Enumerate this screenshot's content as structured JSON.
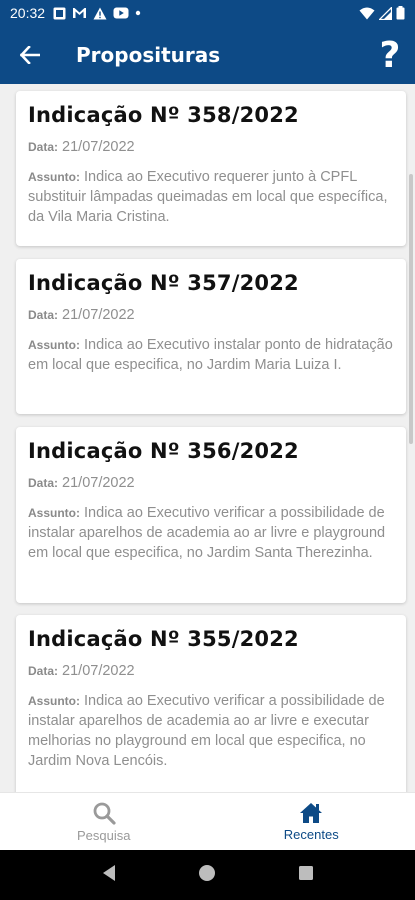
{
  "status": {
    "time": "20:32"
  },
  "header": {
    "title": "Proposituras",
    "help": "?"
  },
  "labels": {
    "date": "Data:",
    "subject": "Assunto:"
  },
  "cards": [
    {
      "title": "Indicação Nº 358/2022",
      "date": "21/07/2022",
      "subject": "Indica ao Executivo requerer junto à CPFL substituir lâmpadas queimadas em local que específica, da Vila Maria Cristina."
    },
    {
      "title": "Indicação Nº 357/2022",
      "date": "21/07/2022",
      "subject": "Indica ao Executivo instalar ponto de hidratação em local que especifica, no Jardim Maria Luiza I."
    },
    {
      "title": "Indicação Nº 356/2022",
      "date": "21/07/2022",
      "subject": "Indica ao Executivo verificar a possibilidade de instalar aparelhos de academia ao ar livre e playground em local que especifica, no Jardim Santa Therezinha."
    },
    {
      "title": "Indicação Nº 355/2022",
      "date": "21/07/2022",
      "subject": "Indica ao Executivo verificar a possibilidade de instalar aparelhos de academia ao ar livre e executar melhorias no playground em local que especifica, no Jardim Nova Lencóis."
    }
  ],
  "bottom_nav": {
    "search": "Pesquisa",
    "recent": "Recentes"
  },
  "colors": {
    "primary": "#0d4a86",
    "inactive": "#9a9a9a"
  }
}
